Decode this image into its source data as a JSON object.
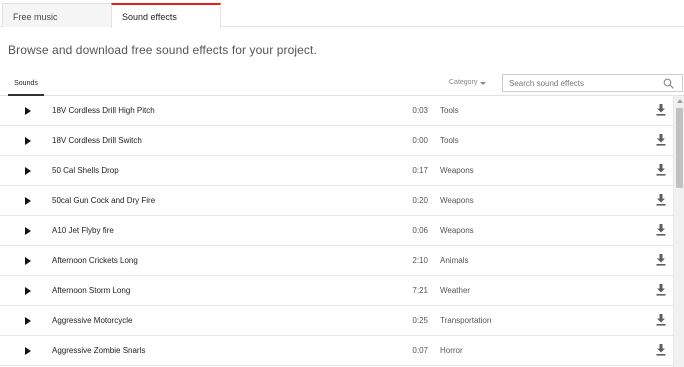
{
  "tabs": [
    {
      "label": "Free music",
      "active": false
    },
    {
      "label": "Sound effects",
      "active": true
    }
  ],
  "subtitle": "Browse and download free sound effects for your project.",
  "filter": {
    "sounds_label": "Sounds",
    "category_label": "Category",
    "search_placeholder": "Search sound effects"
  },
  "colors": {
    "active_tab_accent": "#e62117"
  },
  "rows": [
    {
      "title": "18V Cordless Drill High Pitch",
      "duration": "0:03",
      "category": "Tools"
    },
    {
      "title": "18V Cordless Drill Switch",
      "duration": "0:00",
      "category": "Tools"
    },
    {
      "title": "50 Cal Shells Drop",
      "duration": "0:17",
      "category": "Weapons"
    },
    {
      "title": "50cal Gun Cock and Dry Fire",
      "duration": "0:20",
      "category": "Weapons"
    },
    {
      "title": "A10 Jet Flyby fire",
      "duration": "0:06",
      "category": "Weapons"
    },
    {
      "title": "Afternoon Crickets Long",
      "duration": "2:10",
      "category": "Animals"
    },
    {
      "title": "Afternoon Storm Long",
      "duration": "7:21",
      "category": "Weather"
    },
    {
      "title": "Aggressive Motorcycle",
      "duration": "0:25",
      "category": "Transportation"
    },
    {
      "title": "Aggressive Zombie Snarls",
      "duration": "0:07",
      "category": "Horror"
    }
  ]
}
